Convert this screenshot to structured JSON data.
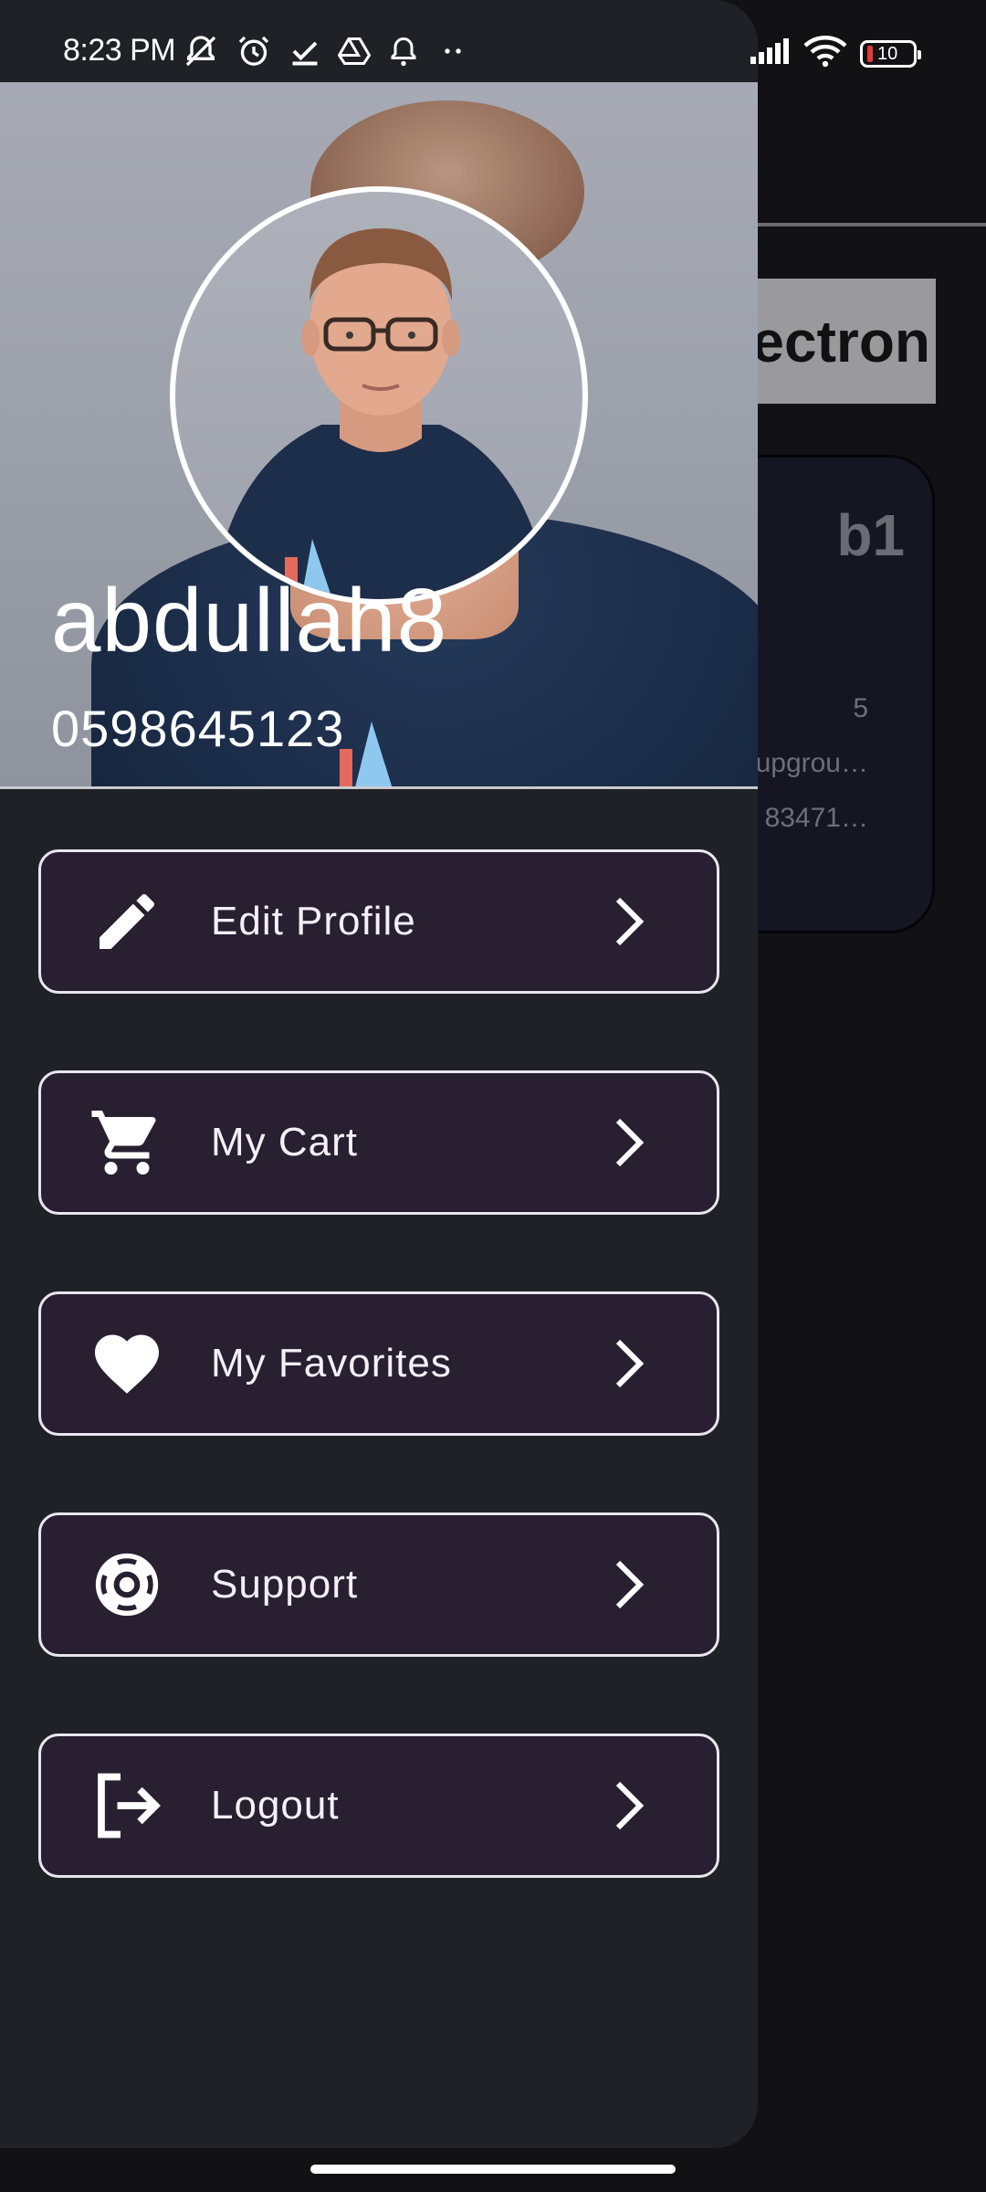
{
  "status_bar": {
    "time": "8:23 PM",
    "battery_level": "10",
    "icons_left": [
      "muted-bell-icon",
      "alarm-icon",
      "check-icon",
      "drive-icon",
      "notification-bell-icon",
      "more-dots-icon"
    ],
    "icons_right": [
      "signal-icon",
      "wifi-icon",
      "battery-icon"
    ]
  },
  "background_app": {
    "category_label": "lectron",
    "card": {
      "title": "b1",
      "lines": [
        "5",
        "upgrou…",
        "83471…"
      ]
    }
  },
  "profile": {
    "username": "abdullah8",
    "phone": "0598645123"
  },
  "menu": {
    "items": [
      {
        "label": "Edit Profile",
        "icon": "pencil-icon"
      },
      {
        "label": "My Cart",
        "icon": "cart-icon"
      },
      {
        "label": "My Favorites",
        "icon": "heart-icon"
      },
      {
        "label": "Support",
        "icon": "lifebuoy-icon"
      },
      {
        "label": "Logout",
        "icon": "logout-icon"
      }
    ]
  },
  "colors": {
    "drawer_bg": "#202126",
    "menu_item_bg": "#281f30",
    "menu_border": "#e8e6ee",
    "app_bg": "#121214",
    "battery_low": "#e53935"
  }
}
